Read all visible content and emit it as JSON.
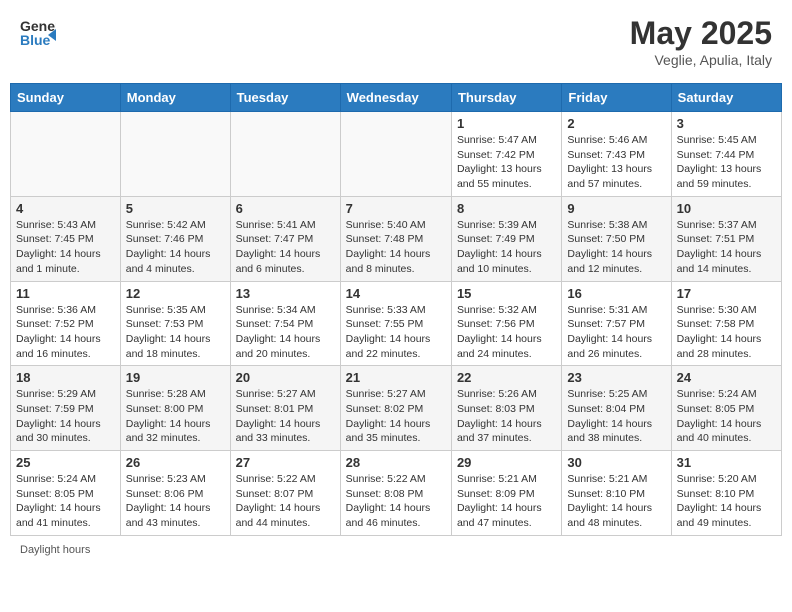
{
  "header": {
    "logo_general": "General",
    "logo_blue": "Blue",
    "month": "May 2025",
    "location": "Veglie, Apulia, Italy"
  },
  "days_of_week": [
    "Sunday",
    "Monday",
    "Tuesday",
    "Wednesday",
    "Thursday",
    "Friday",
    "Saturday"
  ],
  "weeks": [
    [
      {
        "day": "",
        "info": ""
      },
      {
        "day": "",
        "info": ""
      },
      {
        "day": "",
        "info": ""
      },
      {
        "day": "",
        "info": ""
      },
      {
        "day": "1",
        "info": "Sunrise: 5:47 AM\nSunset: 7:42 PM\nDaylight: 13 hours\nand 55 minutes."
      },
      {
        "day": "2",
        "info": "Sunrise: 5:46 AM\nSunset: 7:43 PM\nDaylight: 13 hours\nand 57 minutes."
      },
      {
        "day": "3",
        "info": "Sunrise: 5:45 AM\nSunset: 7:44 PM\nDaylight: 13 hours\nand 59 minutes."
      }
    ],
    [
      {
        "day": "4",
        "info": "Sunrise: 5:43 AM\nSunset: 7:45 PM\nDaylight: 14 hours\nand 1 minute."
      },
      {
        "day": "5",
        "info": "Sunrise: 5:42 AM\nSunset: 7:46 PM\nDaylight: 14 hours\nand 4 minutes."
      },
      {
        "day": "6",
        "info": "Sunrise: 5:41 AM\nSunset: 7:47 PM\nDaylight: 14 hours\nand 6 minutes."
      },
      {
        "day": "7",
        "info": "Sunrise: 5:40 AM\nSunset: 7:48 PM\nDaylight: 14 hours\nand 8 minutes."
      },
      {
        "day": "8",
        "info": "Sunrise: 5:39 AM\nSunset: 7:49 PM\nDaylight: 14 hours\nand 10 minutes."
      },
      {
        "day": "9",
        "info": "Sunrise: 5:38 AM\nSunset: 7:50 PM\nDaylight: 14 hours\nand 12 minutes."
      },
      {
        "day": "10",
        "info": "Sunrise: 5:37 AM\nSunset: 7:51 PM\nDaylight: 14 hours\nand 14 minutes."
      }
    ],
    [
      {
        "day": "11",
        "info": "Sunrise: 5:36 AM\nSunset: 7:52 PM\nDaylight: 14 hours\nand 16 minutes."
      },
      {
        "day": "12",
        "info": "Sunrise: 5:35 AM\nSunset: 7:53 PM\nDaylight: 14 hours\nand 18 minutes."
      },
      {
        "day": "13",
        "info": "Sunrise: 5:34 AM\nSunset: 7:54 PM\nDaylight: 14 hours\nand 20 minutes."
      },
      {
        "day": "14",
        "info": "Sunrise: 5:33 AM\nSunset: 7:55 PM\nDaylight: 14 hours\nand 22 minutes."
      },
      {
        "day": "15",
        "info": "Sunrise: 5:32 AM\nSunset: 7:56 PM\nDaylight: 14 hours\nand 24 minutes."
      },
      {
        "day": "16",
        "info": "Sunrise: 5:31 AM\nSunset: 7:57 PM\nDaylight: 14 hours\nand 26 minutes."
      },
      {
        "day": "17",
        "info": "Sunrise: 5:30 AM\nSunset: 7:58 PM\nDaylight: 14 hours\nand 28 minutes."
      }
    ],
    [
      {
        "day": "18",
        "info": "Sunrise: 5:29 AM\nSunset: 7:59 PM\nDaylight: 14 hours\nand 30 minutes."
      },
      {
        "day": "19",
        "info": "Sunrise: 5:28 AM\nSunset: 8:00 PM\nDaylight: 14 hours\nand 32 minutes."
      },
      {
        "day": "20",
        "info": "Sunrise: 5:27 AM\nSunset: 8:01 PM\nDaylight: 14 hours\nand 33 minutes."
      },
      {
        "day": "21",
        "info": "Sunrise: 5:27 AM\nSunset: 8:02 PM\nDaylight: 14 hours\nand 35 minutes."
      },
      {
        "day": "22",
        "info": "Sunrise: 5:26 AM\nSunset: 8:03 PM\nDaylight: 14 hours\nand 37 minutes."
      },
      {
        "day": "23",
        "info": "Sunrise: 5:25 AM\nSunset: 8:04 PM\nDaylight: 14 hours\nand 38 minutes."
      },
      {
        "day": "24",
        "info": "Sunrise: 5:24 AM\nSunset: 8:05 PM\nDaylight: 14 hours\nand 40 minutes."
      }
    ],
    [
      {
        "day": "25",
        "info": "Sunrise: 5:24 AM\nSunset: 8:05 PM\nDaylight: 14 hours\nand 41 minutes."
      },
      {
        "day": "26",
        "info": "Sunrise: 5:23 AM\nSunset: 8:06 PM\nDaylight: 14 hours\nand 43 minutes."
      },
      {
        "day": "27",
        "info": "Sunrise: 5:22 AM\nSunset: 8:07 PM\nDaylight: 14 hours\nand 44 minutes."
      },
      {
        "day": "28",
        "info": "Sunrise: 5:22 AM\nSunset: 8:08 PM\nDaylight: 14 hours\nand 46 minutes."
      },
      {
        "day": "29",
        "info": "Sunrise: 5:21 AM\nSunset: 8:09 PM\nDaylight: 14 hours\nand 47 minutes."
      },
      {
        "day": "30",
        "info": "Sunrise: 5:21 AM\nSunset: 8:10 PM\nDaylight: 14 hours\nand 48 minutes."
      },
      {
        "day": "31",
        "info": "Sunrise: 5:20 AM\nSunset: 8:10 PM\nDaylight: 14 hours\nand 49 minutes."
      }
    ]
  ],
  "footer": {
    "daylight_label": "Daylight hours"
  }
}
